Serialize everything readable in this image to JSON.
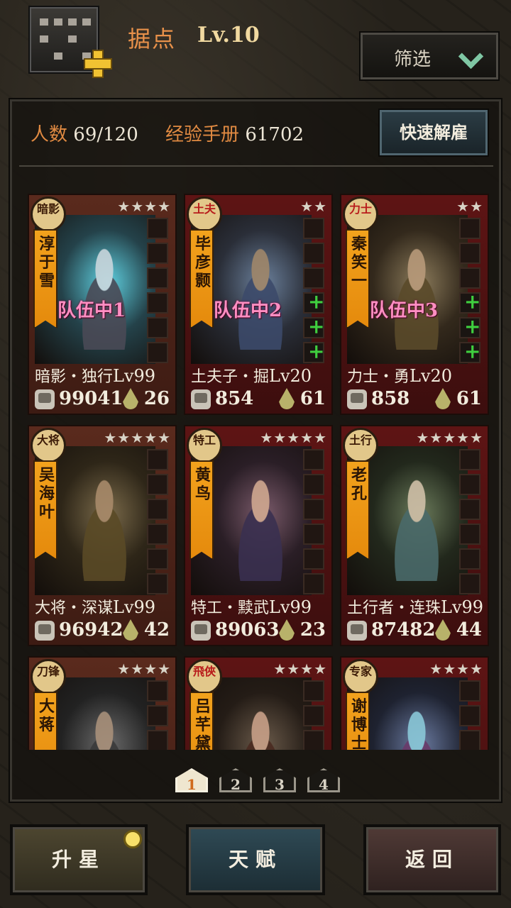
{
  "header": {
    "title": "据点",
    "level": "Lv.10",
    "filter_label": "筛选"
  },
  "stats": {
    "members_label": "人数",
    "members_value": "69/120",
    "exp_label": "经验手册",
    "exp_value": "61702",
    "quick_fire_label": "快速解雇"
  },
  "heroes": [
    {
      "badge": "暗影",
      "name": "淳于雪",
      "stars": "★★★★",
      "role": "暗影・独行",
      "level": "Lv99",
      "power": "99041",
      "morale": "26",
      "team": "队伍中1",
      "plus_slots": 0
    },
    {
      "badge": "土夫",
      "name": "毕彦颢",
      "stars": "★★",
      "role": "土夫子・掘",
      "level": "Lv20",
      "power": "854",
      "morale": "61",
      "team": "队伍中2",
      "plus_slots": 3
    },
    {
      "badge": "力士",
      "name": "秦笑一",
      "stars": "★★",
      "role": "力士・勇",
      "level": "Lv20",
      "power": "858",
      "morale": "61",
      "team": "队伍中3",
      "plus_slots": 3
    },
    {
      "badge": "大将",
      "name": "吴海叶",
      "stars": "★★★★★",
      "role": "大将・深谋",
      "level": "Lv99",
      "power": "96942",
      "morale": "42",
      "team": "",
      "plus_slots": 0
    },
    {
      "badge": "特工",
      "name": "黄鸟",
      "stars": "★★★★★",
      "role": "特工・黩武",
      "level": "Lv99",
      "power": "89063",
      "morale": "23",
      "team": "",
      "plus_slots": 0
    },
    {
      "badge": "土行",
      "name": "老孔",
      "stars": "★★★★★",
      "role": "土行者・连珠",
      "level": "Lv99",
      "power": "87482",
      "morale": "44",
      "team": "",
      "plus_slots": 0
    },
    {
      "badge": "刀锋",
      "name": "大蒋",
      "stars": "★★★★",
      "role": "",
      "level": "",
      "power": "",
      "morale": "",
      "team": "",
      "plus_slots": 0
    },
    {
      "badge": "飛俠",
      "name": "吕芊黛",
      "stars": "★★★★",
      "role": "",
      "level": "",
      "power": "",
      "morale": "",
      "team": "",
      "plus_slots": 0
    },
    {
      "badge": "专家",
      "name": "谢博士",
      "stars": "★★★★",
      "role": "",
      "level": "",
      "power": "",
      "morale": "",
      "team": "",
      "plus_slots": 0
    }
  ],
  "pager": {
    "pages": [
      "1",
      "2",
      "3",
      "4"
    ],
    "active_page": 1
  },
  "bottom": {
    "star_up_label": "升星",
    "talent_label": "天赋",
    "back_label": "返回"
  },
  "colors": {
    "accent_orange": "#e08a42",
    "team_tag": "#ff8ec2",
    "plus_green": "#3fcf3f"
  }
}
